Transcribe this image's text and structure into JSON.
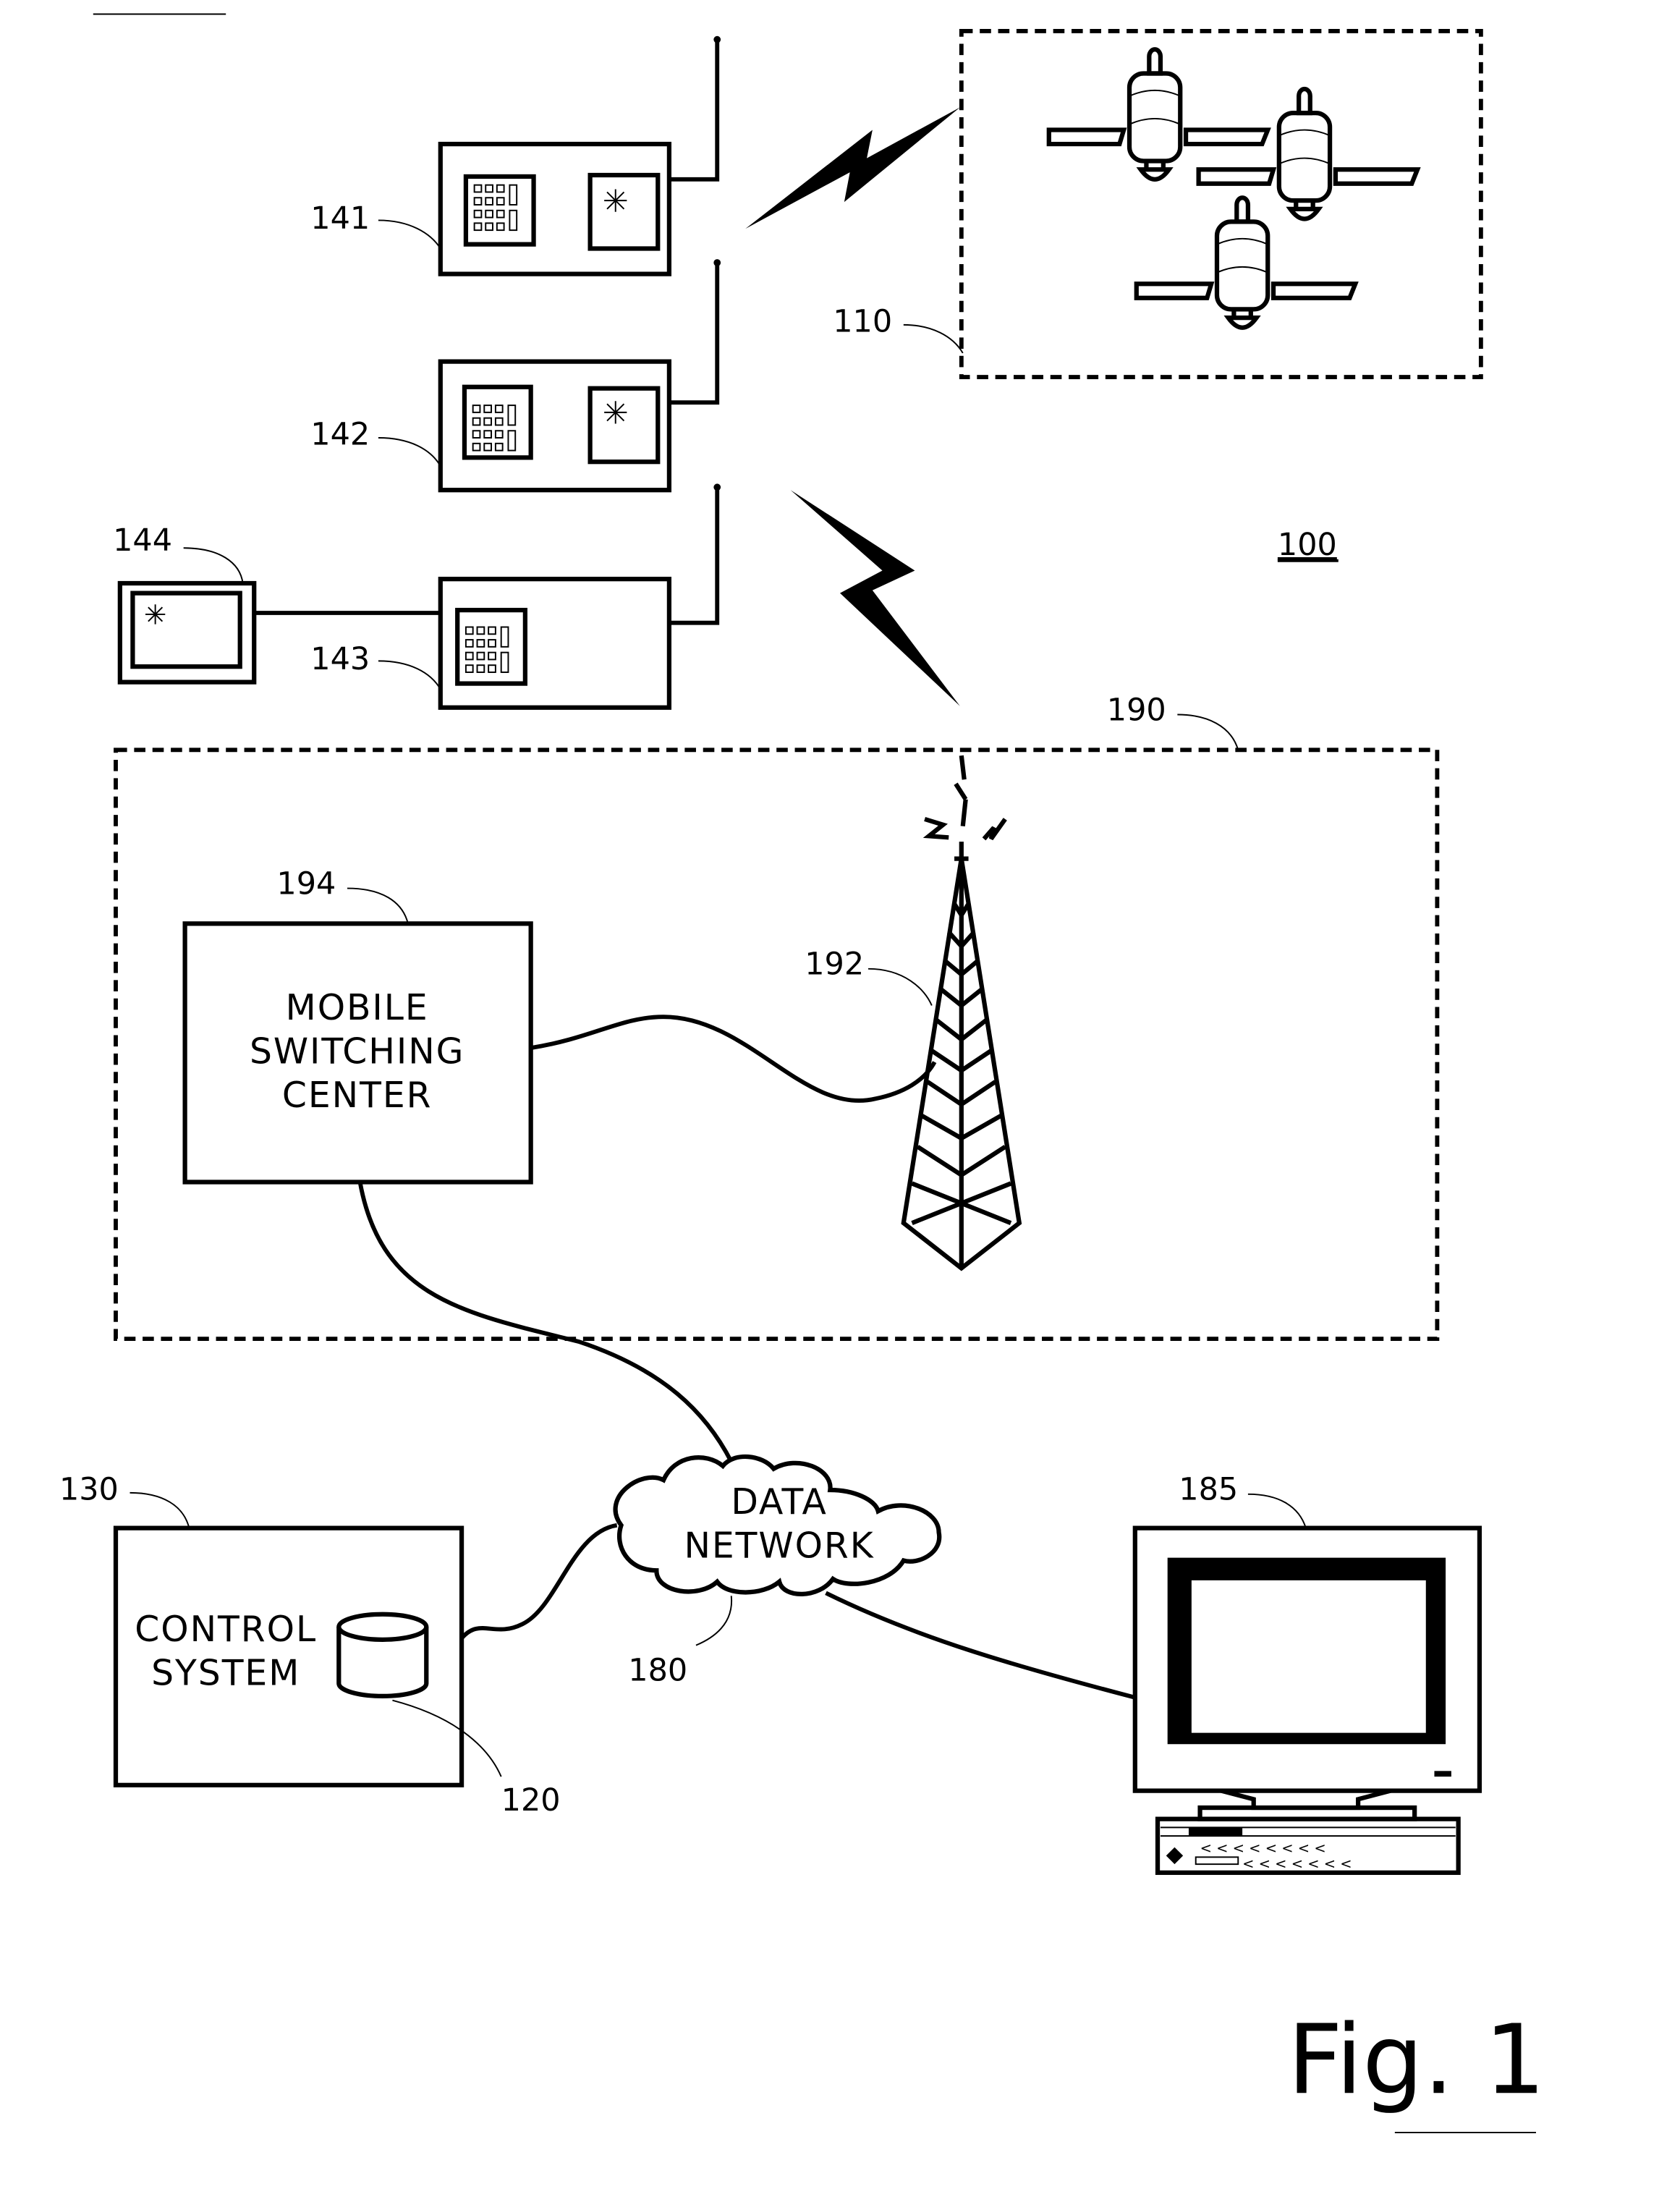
{
  "figure": {
    "title": "Fig. 1",
    "system_ref": "100"
  },
  "labels": {
    "satellites": "110",
    "database": "120",
    "control_system": "130",
    "device_141": "141",
    "device_142": "142",
    "device_143": "143",
    "display_144": "144",
    "data_network": "180",
    "computer": "185",
    "cellular_network": "190",
    "tower": "192",
    "msc": "194"
  },
  "boxes": {
    "msc_lines": [
      "MOBILE",
      "SWITCHING",
      "CENTER"
    ],
    "control_lines": [
      "CONTROL",
      "SYSTEM"
    ],
    "network_lines": [
      "DATA",
      "NETWORK"
    ]
  }
}
